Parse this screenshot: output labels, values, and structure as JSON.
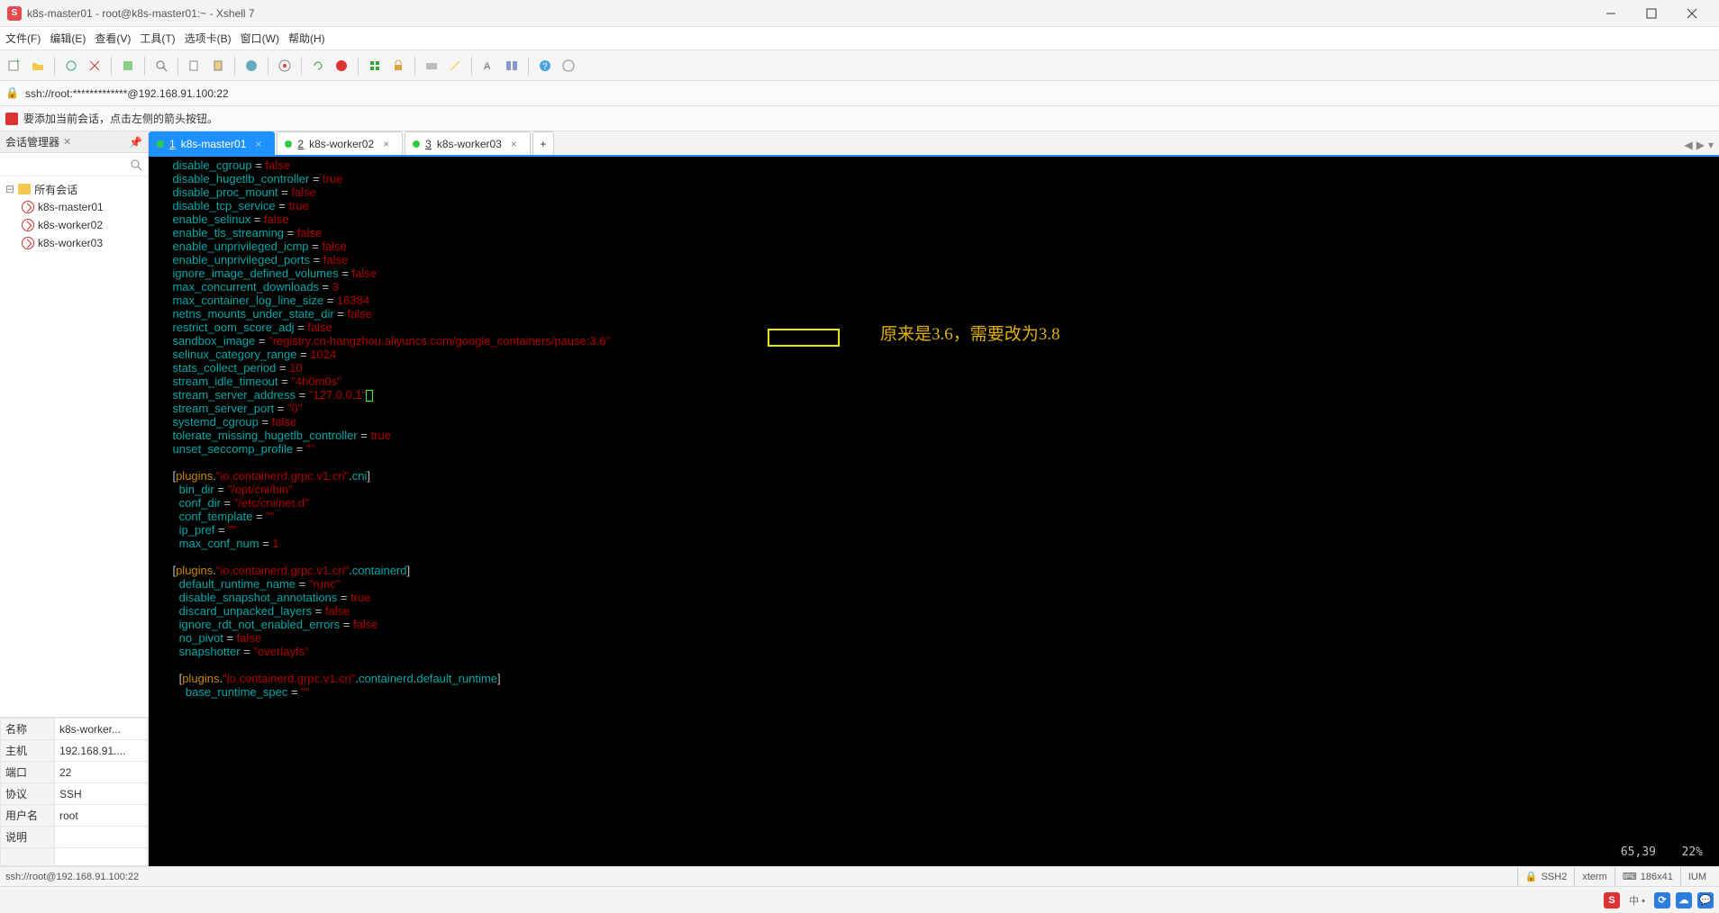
{
  "title": "k8s-master01 - root@k8s-master01:~ - Xshell 7",
  "menus": [
    "文件(F)",
    "编辑(E)",
    "查看(V)",
    "工具(T)",
    "选项卡(B)",
    "窗口(W)",
    "帮助(H)"
  ],
  "addrbar": "ssh://root:*************@192.168.91.100:22",
  "infobar": "要添加当前会话，点击左侧的箭头按钮。",
  "sidebar": {
    "title": "会话管理器",
    "root": "所有会话",
    "sessions": [
      "k8s-master01",
      "k8s-worker02",
      "k8s-worker03"
    ],
    "props": {
      "name_k": "名称",
      "name_v": "k8s-worker...",
      "host_k": "主机",
      "host_v": "192.168.91....",
      "port_k": "端口",
      "port_v": "22",
      "proto_k": "协议",
      "proto_v": "SSH",
      "user_k": "用户名",
      "user_v": "root",
      "desc_k": "说明",
      "desc_v": ""
    }
  },
  "tabs": [
    {
      "n": "1",
      "label": "k8s-master01",
      "active": true
    },
    {
      "n": "2",
      "label": "k8s-worker02",
      "active": false
    },
    {
      "n": "3",
      "label": "k8s-worker03",
      "active": false
    }
  ],
  "term": {
    "lines": [
      {
        "k": "disable_cgroup",
        "v": "false",
        "t": "bool"
      },
      {
        "k": "disable_hugetlb_controller",
        "v": "true",
        "t": "bool"
      },
      {
        "k": "disable_proc_mount",
        "v": "false",
        "t": "bool"
      },
      {
        "k": "disable_tcp_service",
        "v": "true",
        "t": "bool"
      },
      {
        "k": "enable_selinux",
        "v": "false",
        "t": "bool"
      },
      {
        "k": "enable_tls_streaming",
        "v": "false",
        "t": "bool"
      },
      {
        "k": "enable_unprivileged_icmp",
        "v": "false",
        "t": "bool"
      },
      {
        "k": "enable_unprivileged_ports",
        "v": "false",
        "t": "bool"
      },
      {
        "k": "ignore_image_defined_volumes",
        "v": "false",
        "t": "bool"
      },
      {
        "k": "max_concurrent_downloads",
        "v": "3",
        "t": "bool"
      },
      {
        "k": "max_container_log_line_size",
        "v": "16384",
        "t": "bool"
      },
      {
        "k": "netns_mounts_under_state_dir",
        "v": "false",
        "t": "bool"
      },
      {
        "k": "restrict_oom_score_adj",
        "v": "false",
        "t": "bool"
      },
      {
        "k": "sandbox_image",
        "v": "\"registry.cn-hangzhou.aliyuncs.com/google_containers/pause:3.6\"",
        "t": "str"
      },
      {
        "k": "selinux_category_range",
        "v": "1024",
        "t": "bool"
      },
      {
        "k": "stats_collect_period",
        "v": "10",
        "t": "bool"
      },
      {
        "k": "stream_idle_timeout",
        "v": "\"4h0m0s\"",
        "t": "str"
      },
      {
        "k": "stream_server_address",
        "v": "\"127.0.0.1\"",
        "t": "str",
        "cursor": true
      },
      {
        "k": "stream_server_port",
        "v": "\"0\"",
        "t": "str"
      },
      {
        "k": "systemd_cgroup",
        "v": "false",
        "t": "bool"
      },
      {
        "k": "tolerate_missing_hugetlb_controller",
        "v": "true",
        "t": "bool"
      },
      {
        "k": "unset_seccomp_profile",
        "v": "\"\"",
        "t": "str"
      }
    ],
    "section1_parts": [
      "[plugins.",
      "\"io.containerd.grpc.v1.cri\"",
      ".cni]"
    ],
    "cni": [
      {
        "k": "bin_dir",
        "v": "\"/opt/cni/bin\"",
        "t": "str"
      },
      {
        "k": "conf_dir",
        "v": "\"/etc/cni/net.d\"",
        "t": "str"
      },
      {
        "k": "conf_template",
        "v": "\"\"",
        "t": "str"
      },
      {
        "k": "ip_pref",
        "v": "\"\"",
        "t": "str"
      },
      {
        "k": "max_conf_num",
        "v": "1",
        "t": "bool"
      }
    ],
    "section2_parts": [
      "[plugins.",
      "\"io.containerd.grpc.v1.cri\"",
      ".containerd]"
    ],
    "containerd": [
      {
        "k": "default_runtime_name",
        "v": "\"runc\"",
        "t": "str"
      },
      {
        "k": "disable_snapshot_annotations",
        "v": "true",
        "t": "bool"
      },
      {
        "k": "discard_unpacked_layers",
        "v": "false",
        "t": "bool"
      },
      {
        "k": "ignore_rdt_not_enabled_errors",
        "v": "false",
        "t": "bool"
      },
      {
        "k": "no_pivot",
        "v": "false",
        "t": "bool"
      },
      {
        "k": "snapshotter",
        "v": "\"overlayfs\"",
        "t": "str"
      }
    ],
    "section3_parts": [
      "[plugins.",
      "\"io.containerd.grpc.v1.cri\"",
      ".containerd.default_runtime]"
    ],
    "rt": [
      {
        "k": "base_runtime_spec",
        "v": "\"\"",
        "t": "str"
      }
    ],
    "annotation": "原来是3.6，需要改为3.8",
    "pos": "65,39",
    "pct": "22%"
  },
  "status": {
    "left": "ssh://root@192.168.91.100:22",
    "ssh": "SSH2",
    "term": "xterm",
    "size": "186x41",
    "extra": "IUM"
  }
}
